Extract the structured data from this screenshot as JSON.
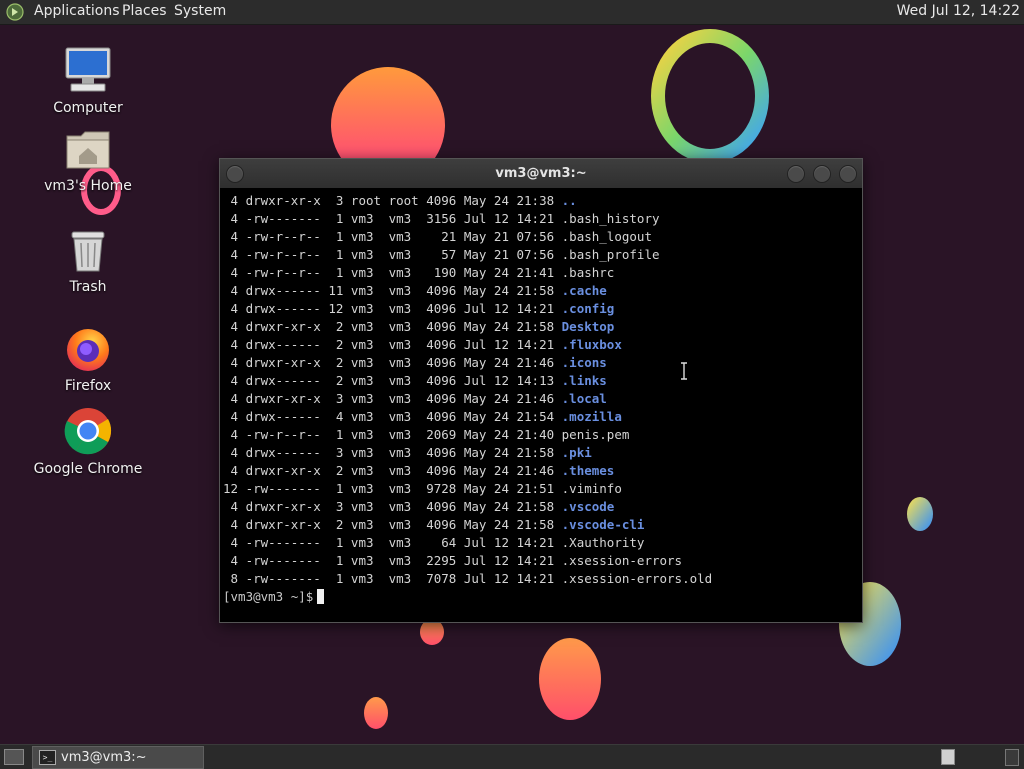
{
  "top_panel": {
    "menus": [
      "Applications",
      "Places",
      "System"
    ],
    "clock": "Wed Jul 12, 14:22"
  },
  "desktop_icons": [
    {
      "label": "Computer",
      "icon": "computer-icon"
    },
    {
      "label": "vm3's Home",
      "icon": "home-folder-icon"
    },
    {
      "label": "Trash",
      "icon": "trash-icon"
    },
    {
      "label": "Firefox",
      "icon": "firefox-icon"
    },
    {
      "label": "Google Chrome",
      "icon": "chrome-icon"
    }
  ],
  "terminal": {
    "title": "vm3@vm3:~",
    "lines": [
      {
        "size": " 4",
        "perms": "drwxr-xr-x",
        "links": " 3",
        "owner": "root",
        "group": "root",
        "bytes": "4096",
        "date": "May 24 21:38",
        "name": "..",
        "is_dir": true
      },
      {
        "size": " 4",
        "perms": "-rw-------",
        "links": " 1",
        "owner": "vm3 ",
        "group": "vm3 ",
        "bytes": "3156",
        "date": "Jul 12 14:21",
        "name": ".bash_history",
        "is_dir": false
      },
      {
        "size": " 4",
        "perms": "-rw-r--r--",
        "links": " 1",
        "owner": "vm3 ",
        "group": "vm3 ",
        "bytes": "  21",
        "date": "May 21 07:56",
        "name": ".bash_logout",
        "is_dir": false
      },
      {
        "size": " 4",
        "perms": "-rw-r--r--",
        "links": " 1",
        "owner": "vm3 ",
        "group": "vm3 ",
        "bytes": "  57",
        "date": "May 21 07:56",
        "name": ".bash_profile",
        "is_dir": false
      },
      {
        "size": " 4",
        "perms": "-rw-r--r--",
        "links": " 1",
        "owner": "vm3 ",
        "group": "vm3 ",
        "bytes": " 190",
        "date": "May 24 21:41",
        "name": ".bashrc",
        "is_dir": false
      },
      {
        "size": " 4",
        "perms": "drwx------",
        "links": "11",
        "owner": "vm3 ",
        "group": "vm3 ",
        "bytes": "4096",
        "date": "May 24 21:58",
        "name": ".cache",
        "is_dir": true
      },
      {
        "size": " 4",
        "perms": "drwx------",
        "links": "12",
        "owner": "vm3 ",
        "group": "vm3 ",
        "bytes": "4096",
        "date": "Jul 12 14:21",
        "name": ".config",
        "is_dir": true
      },
      {
        "size": " 4",
        "perms": "drwxr-xr-x",
        "links": " 2",
        "owner": "vm3 ",
        "group": "vm3 ",
        "bytes": "4096",
        "date": "May 24 21:58",
        "name": "Desktop",
        "is_dir": true
      },
      {
        "size": " 4",
        "perms": "drwx------",
        "links": " 2",
        "owner": "vm3 ",
        "group": "vm3 ",
        "bytes": "4096",
        "date": "Jul 12 14:21",
        "name": ".fluxbox",
        "is_dir": true
      },
      {
        "size": " 4",
        "perms": "drwxr-xr-x",
        "links": " 2",
        "owner": "vm3 ",
        "group": "vm3 ",
        "bytes": "4096",
        "date": "May 24 21:46",
        "name": ".icons",
        "is_dir": true
      },
      {
        "size": " 4",
        "perms": "drwx------",
        "links": " 2",
        "owner": "vm3 ",
        "group": "vm3 ",
        "bytes": "4096",
        "date": "Jul 12 14:13",
        "name": ".links",
        "is_dir": true
      },
      {
        "size": " 4",
        "perms": "drwxr-xr-x",
        "links": " 3",
        "owner": "vm3 ",
        "group": "vm3 ",
        "bytes": "4096",
        "date": "May 24 21:46",
        "name": ".local",
        "is_dir": true
      },
      {
        "size": " 4",
        "perms": "drwx------",
        "links": " 4",
        "owner": "vm3 ",
        "group": "vm3 ",
        "bytes": "4096",
        "date": "May 24 21:54",
        "name": ".mozilla",
        "is_dir": true
      },
      {
        "size": " 4",
        "perms": "-rw-r--r--",
        "links": " 1",
        "owner": "vm3 ",
        "group": "vm3 ",
        "bytes": "2069",
        "date": "May 24 21:40",
        "name": "penis.pem",
        "is_dir": false
      },
      {
        "size": " 4",
        "perms": "drwx------",
        "links": " 3",
        "owner": "vm3 ",
        "group": "vm3 ",
        "bytes": "4096",
        "date": "May 24 21:58",
        "name": ".pki",
        "is_dir": true
      },
      {
        "size": " 4",
        "perms": "drwxr-xr-x",
        "links": " 2",
        "owner": "vm3 ",
        "group": "vm3 ",
        "bytes": "4096",
        "date": "May 24 21:46",
        "name": ".themes",
        "is_dir": true
      },
      {
        "size": "12",
        "perms": "-rw-------",
        "links": " 1",
        "owner": "vm3 ",
        "group": "vm3 ",
        "bytes": "9728",
        "date": "May 24 21:51",
        "name": ".viminfo",
        "is_dir": false
      },
      {
        "size": " 4",
        "perms": "drwxr-xr-x",
        "links": " 3",
        "owner": "vm3 ",
        "group": "vm3 ",
        "bytes": "4096",
        "date": "May 24 21:58",
        "name": ".vscode",
        "is_dir": true
      },
      {
        "size": " 4",
        "perms": "drwxr-xr-x",
        "links": " 2",
        "owner": "vm3 ",
        "group": "vm3 ",
        "bytes": "4096",
        "date": "May 24 21:58",
        "name": ".vscode-cli",
        "is_dir": true
      },
      {
        "size": " 4",
        "perms": "-rw-------",
        "links": " 1",
        "owner": "vm3 ",
        "group": "vm3 ",
        "bytes": "  64",
        "date": "Jul 12 14:21",
        "name": ".Xauthority",
        "is_dir": false
      },
      {
        "size": " 4",
        "perms": "-rw-------",
        "links": " 1",
        "owner": "vm3 ",
        "group": "vm3 ",
        "bytes": "2295",
        "date": "Jul 12 14:21",
        "name": ".xsession-errors",
        "is_dir": false
      },
      {
        "size": " 8",
        "perms": "-rw-------",
        "links": " 1",
        "owner": "vm3 ",
        "group": "vm3 ",
        "bytes": "7078",
        "date": "Jul 12 14:21",
        "name": ".xsession-errors.old",
        "is_dir": false
      }
    ],
    "prompt": "[vm3@vm3 ~]$"
  },
  "taskbar": {
    "task_label": "vm3@vm3:~"
  },
  "colors": {
    "directory": "#6a8fe0",
    "terminal_bg": "#000000",
    "panel_bg": "#2c2c2c"
  }
}
